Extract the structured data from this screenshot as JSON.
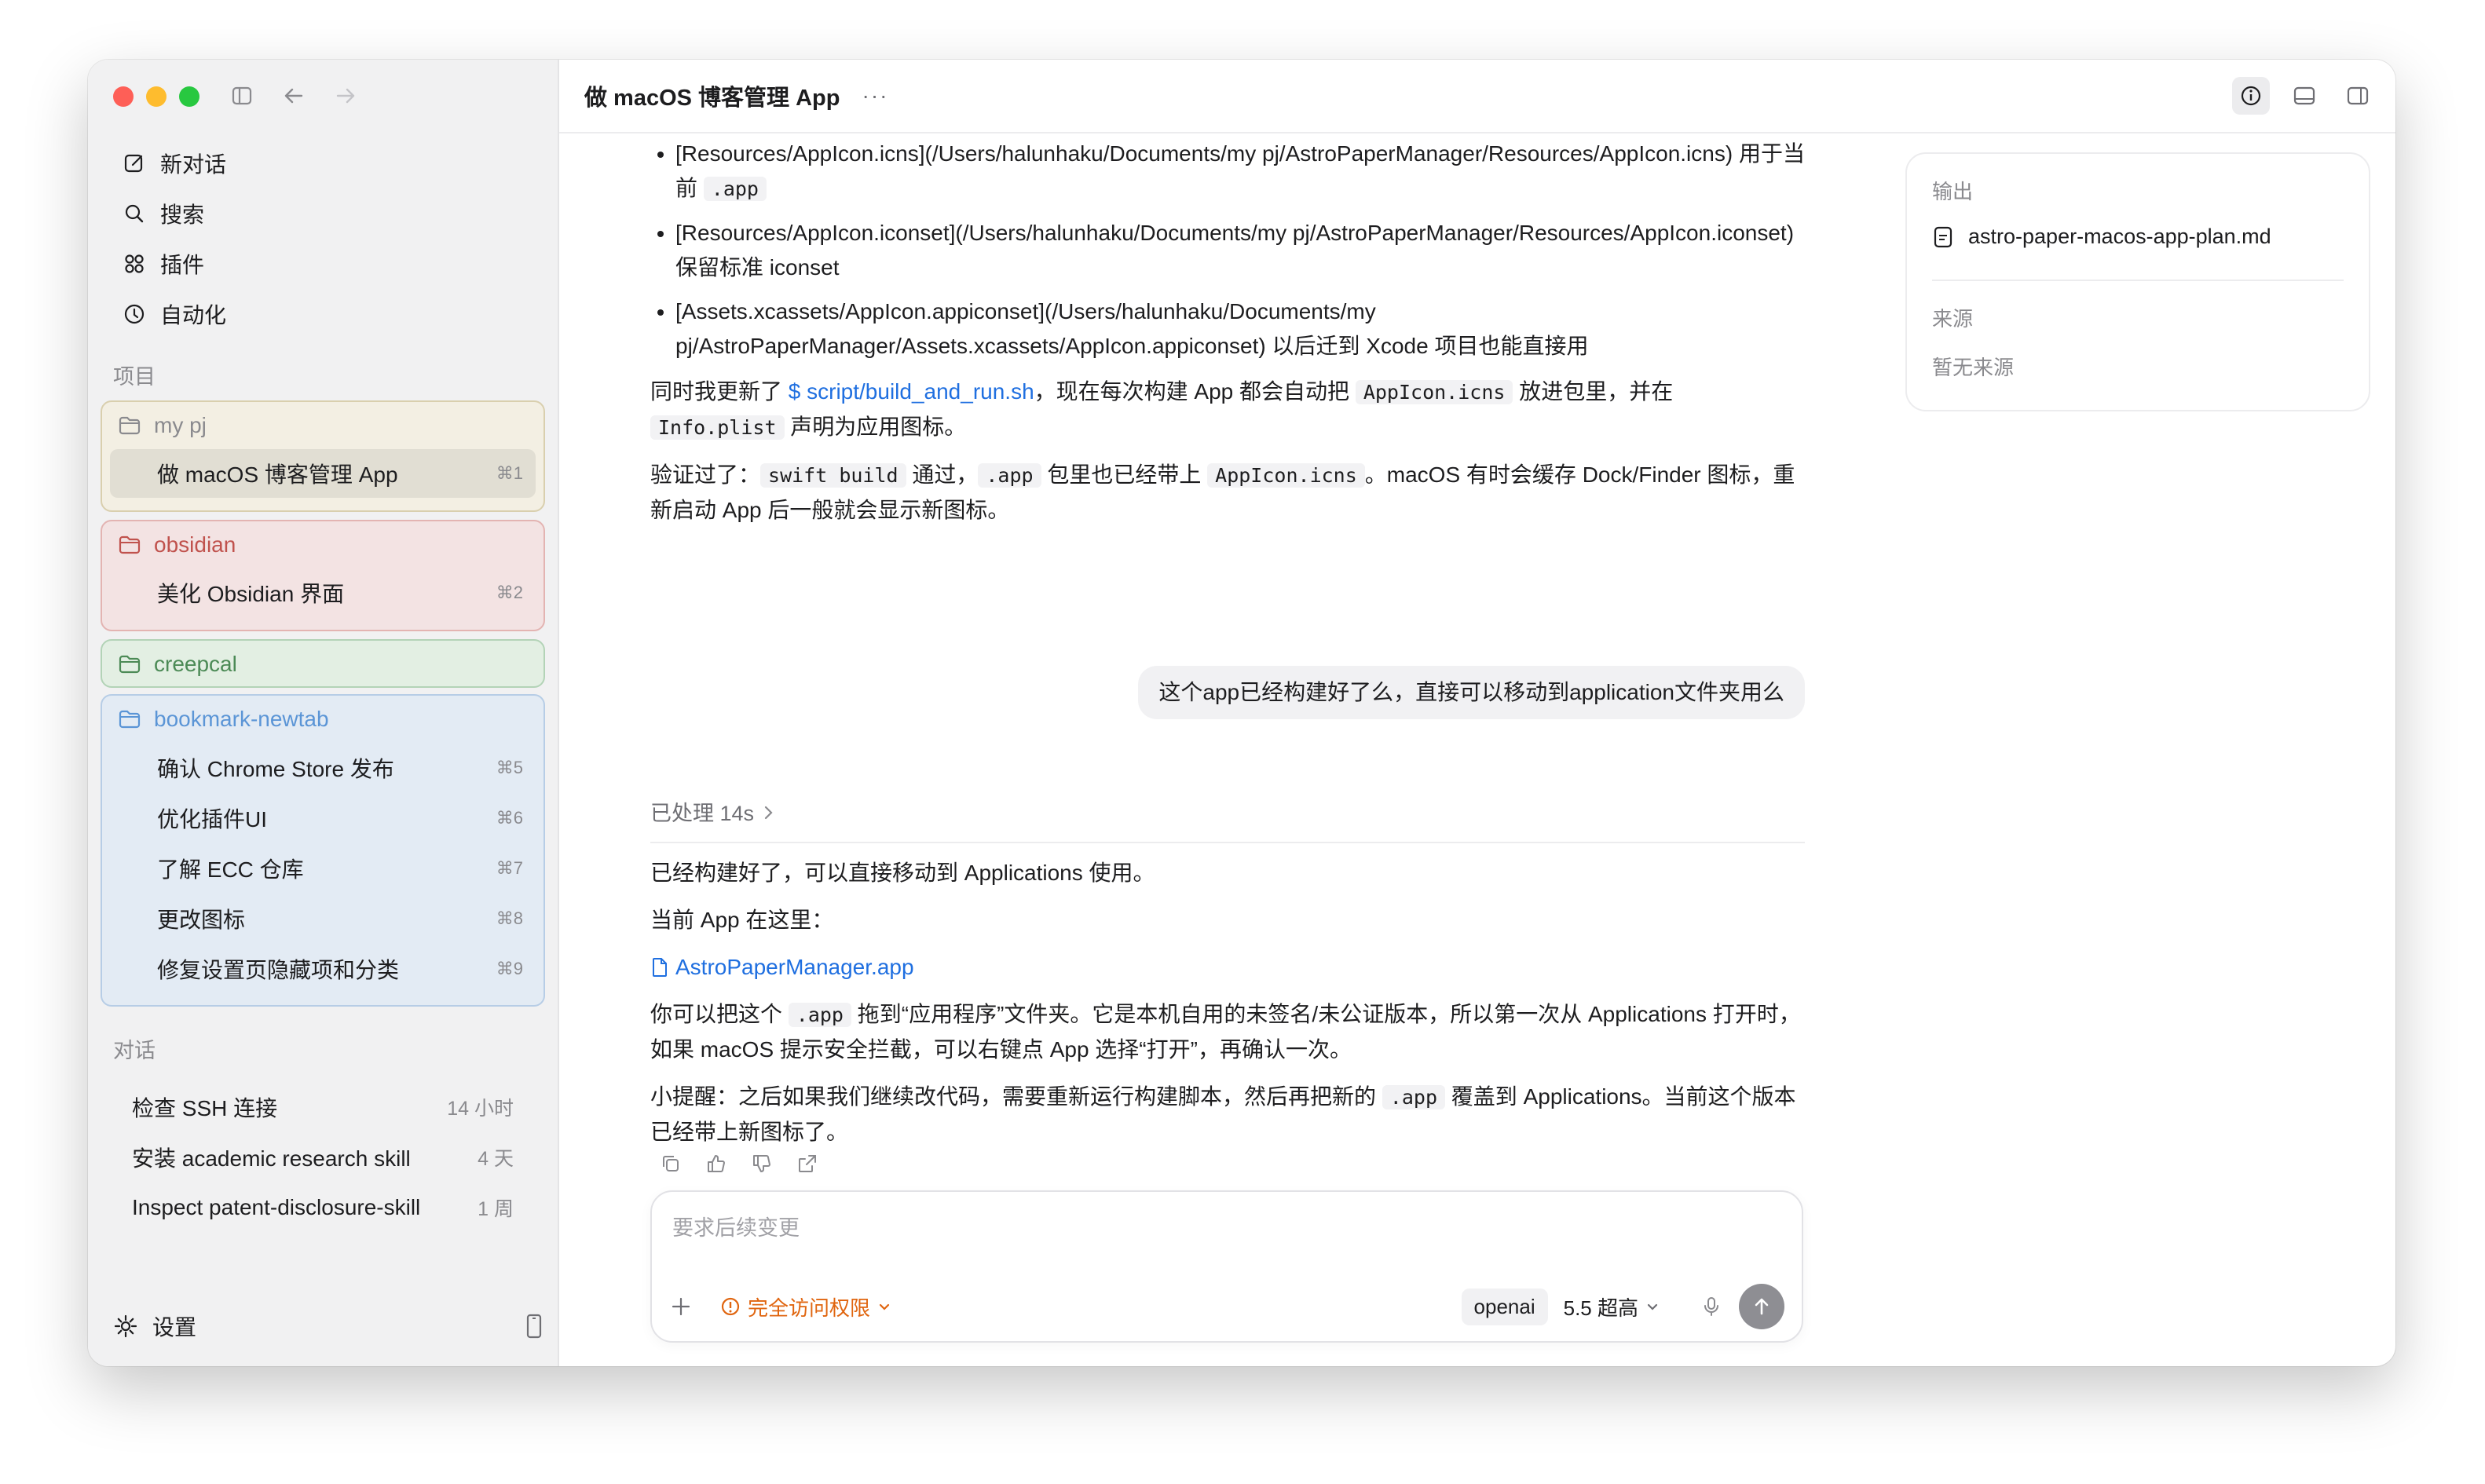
{
  "sidebar": {
    "nav": [
      {
        "label": "新对话",
        "icon": "compose-icon"
      },
      {
        "label": "搜索",
        "icon": "search-icon"
      },
      {
        "label": "插件",
        "icon": "plugins-icon"
      },
      {
        "label": "自动化",
        "icon": "clock-icon"
      }
    ],
    "projects_label": "项目",
    "projects": [
      {
        "name": "my pj",
        "color": "#8a8a8e",
        "bg": "#f3efe3",
        "border": "#d9cfae",
        "items": [
          {
            "label": "做 macOS 博客管理 App",
            "kbd": "⌘1",
            "active": true
          }
        ]
      },
      {
        "name": "obsidian",
        "color": "#c0524d",
        "bg": "#f3e3e3",
        "border": "#e3b4b2",
        "items": [
          {
            "label": "美化 Obsidian 界面",
            "kbd": "⌘2",
            "active": false
          }
        ]
      },
      {
        "name": "creepcal",
        "color": "#4c8a56",
        "bg": "#e3efe3",
        "border": "#b3d3b7",
        "items": []
      },
      {
        "name": "bookmark-newtab",
        "color": "#5b95d6",
        "bg": "#e3ebf4",
        "border": "#b7cde6",
        "items": [
          {
            "label": "确认 Chrome Store 发布",
            "kbd": "⌘5",
            "active": false
          },
          {
            "label": "优化插件UI",
            "kbd": "⌘6",
            "active": false
          },
          {
            "label": "了解 ECC 仓库",
            "kbd": "⌘7",
            "active": false
          },
          {
            "label": "更改图标",
            "kbd": "⌘8",
            "active": false
          },
          {
            "label": "修复设置页隐藏项和分类",
            "kbd": "⌘9",
            "active": false
          }
        ]
      }
    ],
    "conversations_label": "对话",
    "conversations": [
      {
        "label": "检查 SSH 连接",
        "time": "14 小时"
      },
      {
        "label": "安装 academic research skill",
        "time": "4 天"
      },
      {
        "label": "Inspect patent-disclosure-skill",
        "time": "1 周"
      }
    ],
    "settings_label": "设置"
  },
  "header": {
    "title": "做 macOS 博客管理 App",
    "more": "···"
  },
  "messages": {
    "bullets": [
      {
        "text": "[Resources/AppIcon.icns](/Users/halunhaku/Documents/my pj/AstroPaperManager/Resources/AppIcon.icns) 用于当前 ",
        "code": ".app"
      },
      {
        "text": "[Resources/AppIcon.iconset](/Users/halunhaku/Documents/my pj/AstroPaperManager/Resources/AppIcon.iconset) 保留标准 iconset",
        "code": ""
      },
      {
        "text": "[Assets.xcassets/AppIcon.appiconset](/Users/halunhaku/Documents/my pj/AstroPaperManager/Assets.xcassets/AppIcon.appiconset) 以后迁到 Xcode 项目也能直接用",
        "code": ""
      }
    ],
    "p1": {
      "a": "同时我更新了 ",
      "link": "$ script/build_and_run.sh",
      "b": "，现在每次构建 App 都会自动把 ",
      "code1": "AppIcon.icns",
      "c": " 放进包里，并在 ",
      "code2": "Info.plist",
      "d": " 声明为应用图标。"
    },
    "p2": {
      "a": "验证过了：",
      "code1": "swift build",
      "b": " 通过，",
      "code2": ".app",
      "c": " 包里也已经带上 ",
      "code3": "AppIcon.icns",
      "d": "。macOS 有时会缓存 Dock/Finder 图标，重新启动 App 后一般就会显示新图标。"
    },
    "user_bubble": "这个app已经构建好了么，直接可以移动到application文件夹用么",
    "processed": "已处理 14s",
    "r1": "已经构建好了，可以直接移动到 Applications 使用。",
    "r2": "当前 App 在这里：",
    "file_link": "AstroPaperManager.app",
    "r3": {
      "a": "你可以把这个 ",
      "code": ".app",
      "b": " 拖到“应用程序”文件夹。它是本机自用的未签名/未公证版本，所以第一次从 Applications 打开时，如果 macOS 提示安全拦截，可以右键点 App 选择“打开”，再确认一次。"
    },
    "r4": {
      "a": "小提醒：之后如果我们继续改代码，需要重新运行构建脚本，然后再把新的 ",
      "code": ".app",
      "b": " 覆盖到 Applications。当前这个版本已经带上新图标了。"
    }
  },
  "composer": {
    "placeholder": "要求后续变更",
    "permission": "完全访问权限",
    "provider": "openai",
    "model": "5.5 超高"
  },
  "right_panel": {
    "output_label": "输出",
    "output_file": "astro-paper-macos-app-plan.md",
    "source_label": "来源",
    "source_empty": "暂无来源"
  }
}
